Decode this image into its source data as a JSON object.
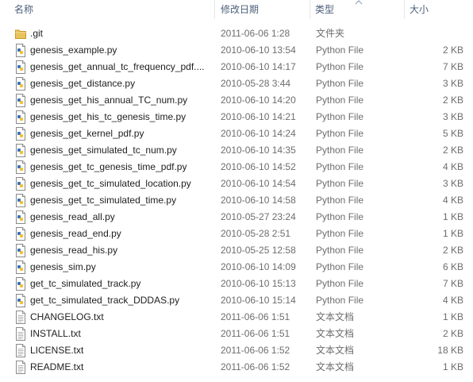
{
  "columns": {
    "name": "名称",
    "date": "修改日期",
    "type": "类型",
    "size": "大小"
  },
  "files": [
    {
      "name": ".git",
      "date": "2011-06-06 1:28",
      "type": "文件夹",
      "size": "",
      "icon": "folder-icon"
    },
    {
      "name": "genesis_example.py",
      "date": "2010-06-10 13:54",
      "type": "Python File",
      "size": "2 KB",
      "icon": "python-file-icon"
    },
    {
      "name": "genesis_get_annual_tc_frequency_pdf....",
      "date": "2010-06-10 14:17",
      "type": "Python File",
      "size": "7 KB",
      "icon": "python-file-icon"
    },
    {
      "name": "genesis_get_distance.py",
      "date": "2010-05-28 3:44",
      "type": "Python File",
      "size": "3 KB",
      "icon": "python-file-icon"
    },
    {
      "name": "genesis_get_his_annual_TC_num.py",
      "date": "2010-06-10 14:20",
      "type": "Python File",
      "size": "2 KB",
      "icon": "python-file-icon"
    },
    {
      "name": "genesis_get_his_tc_genesis_time.py",
      "date": "2010-06-10 14:21",
      "type": "Python File",
      "size": "3 KB",
      "icon": "python-file-icon"
    },
    {
      "name": "genesis_get_kernel_pdf.py",
      "date": "2010-06-10 14:24",
      "type": "Python File",
      "size": "5 KB",
      "icon": "python-file-icon"
    },
    {
      "name": "genesis_get_simulated_tc_num.py",
      "date": "2010-06-10 14:35",
      "type": "Python File",
      "size": "2 KB",
      "icon": "python-file-icon"
    },
    {
      "name": "genesis_get_tc_genesis_time_pdf.py",
      "date": "2010-06-10 14:52",
      "type": "Python File",
      "size": "4 KB",
      "icon": "python-file-icon"
    },
    {
      "name": "genesis_get_tc_simulated_location.py",
      "date": "2010-06-10 14:54",
      "type": "Python File",
      "size": "3 KB",
      "icon": "python-file-icon"
    },
    {
      "name": "genesis_get_tc_simulated_time.py",
      "date": "2010-06-10 14:58",
      "type": "Python File",
      "size": "4 KB",
      "icon": "python-file-icon"
    },
    {
      "name": "genesis_read_all.py",
      "date": "2010-05-27 23:24",
      "type": "Python File",
      "size": "1 KB",
      "icon": "python-file-icon"
    },
    {
      "name": "genesis_read_end.py",
      "date": "2010-05-28 2:51",
      "type": "Python File",
      "size": "1 KB",
      "icon": "python-file-icon"
    },
    {
      "name": "genesis_read_his.py",
      "date": "2010-05-25 12:58",
      "type": "Python File",
      "size": "2 KB",
      "icon": "python-file-icon"
    },
    {
      "name": "genesis_sim.py",
      "date": "2010-06-10 14:09",
      "type": "Python File",
      "size": "6 KB",
      "icon": "python-file-icon"
    },
    {
      "name": "get_tc_simulated_track.py",
      "date": "2010-06-10 15:13",
      "type": "Python File",
      "size": "7 KB",
      "icon": "python-file-icon"
    },
    {
      "name": "get_tc_simulated_track_DDDAS.py",
      "date": "2010-06-10 15:14",
      "type": "Python File",
      "size": "4 KB",
      "icon": "python-file-icon"
    },
    {
      "name": "CHANGELOG.txt",
      "date": "2011-06-06 1:51",
      "type": "文本文档",
      "size": "1 KB",
      "icon": "text-file-icon"
    },
    {
      "name": "INSTALL.txt",
      "date": "2011-06-06 1:51",
      "type": "文本文档",
      "size": "2 KB",
      "icon": "text-file-icon"
    },
    {
      "name": "LICENSE.txt",
      "date": "2011-06-06 1:52",
      "type": "文本文档",
      "size": "18 KB",
      "icon": "text-file-icon"
    },
    {
      "name": "README.txt",
      "date": "2011-06-06 1:52",
      "type": "文本文档",
      "size": "1 KB",
      "icon": "text-file-icon"
    }
  ]
}
